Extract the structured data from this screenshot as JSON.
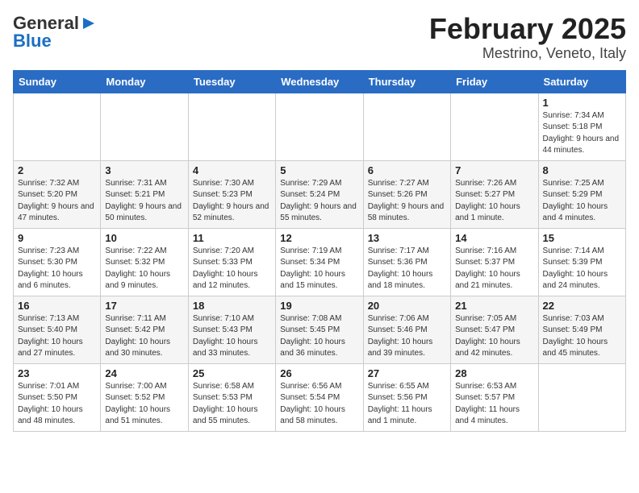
{
  "header": {
    "logo_general": "General",
    "logo_blue": "Blue",
    "title": "February 2025",
    "subtitle": "Mestrino, Veneto, Italy"
  },
  "weekdays": [
    "Sunday",
    "Monday",
    "Tuesday",
    "Wednesday",
    "Thursday",
    "Friday",
    "Saturday"
  ],
  "weeks": [
    [
      {
        "day": "",
        "info": ""
      },
      {
        "day": "",
        "info": ""
      },
      {
        "day": "",
        "info": ""
      },
      {
        "day": "",
        "info": ""
      },
      {
        "day": "",
        "info": ""
      },
      {
        "day": "",
        "info": ""
      },
      {
        "day": "1",
        "info": "Sunrise: 7:34 AM\nSunset: 5:18 PM\nDaylight: 9 hours and 44 minutes."
      }
    ],
    [
      {
        "day": "2",
        "info": "Sunrise: 7:32 AM\nSunset: 5:20 PM\nDaylight: 9 hours and 47 minutes."
      },
      {
        "day": "3",
        "info": "Sunrise: 7:31 AM\nSunset: 5:21 PM\nDaylight: 9 hours and 50 minutes."
      },
      {
        "day": "4",
        "info": "Sunrise: 7:30 AM\nSunset: 5:23 PM\nDaylight: 9 hours and 52 minutes."
      },
      {
        "day": "5",
        "info": "Sunrise: 7:29 AM\nSunset: 5:24 PM\nDaylight: 9 hours and 55 minutes."
      },
      {
        "day": "6",
        "info": "Sunrise: 7:27 AM\nSunset: 5:26 PM\nDaylight: 9 hours and 58 minutes."
      },
      {
        "day": "7",
        "info": "Sunrise: 7:26 AM\nSunset: 5:27 PM\nDaylight: 10 hours and 1 minute."
      },
      {
        "day": "8",
        "info": "Sunrise: 7:25 AM\nSunset: 5:29 PM\nDaylight: 10 hours and 4 minutes."
      }
    ],
    [
      {
        "day": "9",
        "info": "Sunrise: 7:23 AM\nSunset: 5:30 PM\nDaylight: 10 hours and 6 minutes."
      },
      {
        "day": "10",
        "info": "Sunrise: 7:22 AM\nSunset: 5:32 PM\nDaylight: 10 hours and 9 minutes."
      },
      {
        "day": "11",
        "info": "Sunrise: 7:20 AM\nSunset: 5:33 PM\nDaylight: 10 hours and 12 minutes."
      },
      {
        "day": "12",
        "info": "Sunrise: 7:19 AM\nSunset: 5:34 PM\nDaylight: 10 hours and 15 minutes."
      },
      {
        "day": "13",
        "info": "Sunrise: 7:17 AM\nSunset: 5:36 PM\nDaylight: 10 hours and 18 minutes."
      },
      {
        "day": "14",
        "info": "Sunrise: 7:16 AM\nSunset: 5:37 PM\nDaylight: 10 hours and 21 minutes."
      },
      {
        "day": "15",
        "info": "Sunrise: 7:14 AM\nSunset: 5:39 PM\nDaylight: 10 hours and 24 minutes."
      }
    ],
    [
      {
        "day": "16",
        "info": "Sunrise: 7:13 AM\nSunset: 5:40 PM\nDaylight: 10 hours and 27 minutes."
      },
      {
        "day": "17",
        "info": "Sunrise: 7:11 AM\nSunset: 5:42 PM\nDaylight: 10 hours and 30 minutes."
      },
      {
        "day": "18",
        "info": "Sunrise: 7:10 AM\nSunset: 5:43 PM\nDaylight: 10 hours and 33 minutes."
      },
      {
        "day": "19",
        "info": "Sunrise: 7:08 AM\nSunset: 5:45 PM\nDaylight: 10 hours and 36 minutes."
      },
      {
        "day": "20",
        "info": "Sunrise: 7:06 AM\nSunset: 5:46 PM\nDaylight: 10 hours and 39 minutes."
      },
      {
        "day": "21",
        "info": "Sunrise: 7:05 AM\nSunset: 5:47 PM\nDaylight: 10 hours and 42 minutes."
      },
      {
        "day": "22",
        "info": "Sunrise: 7:03 AM\nSunset: 5:49 PM\nDaylight: 10 hours and 45 minutes."
      }
    ],
    [
      {
        "day": "23",
        "info": "Sunrise: 7:01 AM\nSunset: 5:50 PM\nDaylight: 10 hours and 48 minutes."
      },
      {
        "day": "24",
        "info": "Sunrise: 7:00 AM\nSunset: 5:52 PM\nDaylight: 10 hours and 51 minutes."
      },
      {
        "day": "25",
        "info": "Sunrise: 6:58 AM\nSunset: 5:53 PM\nDaylight: 10 hours and 55 minutes."
      },
      {
        "day": "26",
        "info": "Sunrise: 6:56 AM\nSunset: 5:54 PM\nDaylight: 10 hours and 58 minutes."
      },
      {
        "day": "27",
        "info": "Sunrise: 6:55 AM\nSunset: 5:56 PM\nDaylight: 11 hours and 1 minute."
      },
      {
        "day": "28",
        "info": "Sunrise: 6:53 AM\nSunset: 5:57 PM\nDaylight: 11 hours and 4 minutes."
      },
      {
        "day": "",
        "info": ""
      }
    ]
  ]
}
